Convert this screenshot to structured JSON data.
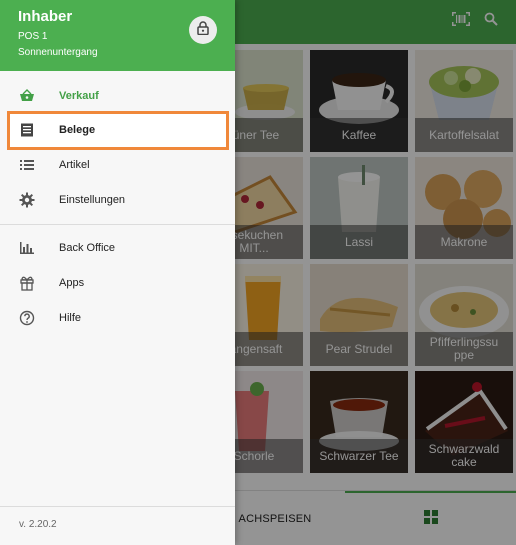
{
  "drawer": {
    "user_name": "Inhaber",
    "pos_name": "POS 1",
    "shift_name": "Sonnenuntergang",
    "menu": [
      {
        "label": "Verkauf",
        "icon": "basket-icon",
        "state": "active"
      },
      {
        "label": "Belege",
        "icon": "receipt-icon",
        "state": "selected"
      },
      {
        "label": "Artikel",
        "icon": "list-icon",
        "state": "normal"
      },
      {
        "label": "Einstellungen",
        "icon": "gear-icon",
        "state": "normal"
      },
      {
        "label": "Back Office",
        "icon": "bar-chart-icon",
        "state": "normal"
      },
      {
        "label": "Apps",
        "icon": "apps-icon",
        "state": "normal"
      },
      {
        "label": "Hilfe",
        "icon": "help-icon",
        "state": "normal"
      }
    ],
    "version": "v. 2.20.2"
  },
  "products": [
    {
      "label": "rüner Tee"
    },
    {
      "label": "Kaffee"
    },
    {
      "label": "Kartoffelsalat"
    },
    {
      "label": "äsekuchen MIT..."
    },
    {
      "label": "Lassi"
    },
    {
      "label": "Makrone"
    },
    {
      "label": "rangensaft"
    },
    {
      "label": "Pear Strudel"
    },
    {
      "label": "Pfifferlingssu ppe"
    },
    {
      "label": "Schorle"
    },
    {
      "label": "Schwarzer Tee"
    },
    {
      "label": "Schwarzwald cake"
    }
  ],
  "bottom_tab": {
    "label": "ACHSPEISEN"
  },
  "colors": {
    "brand_green": "#4caf50",
    "active_green": "#43a047",
    "highlight_orange": "#f0883a"
  }
}
